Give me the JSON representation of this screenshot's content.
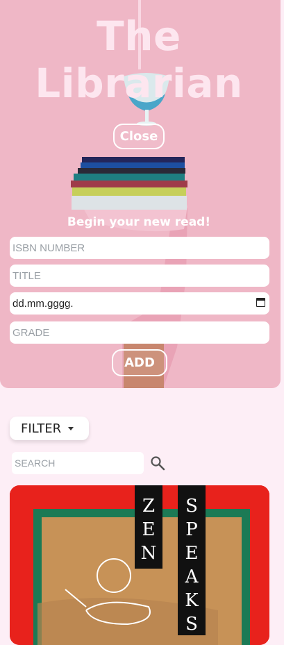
{
  "hero": {
    "title": "The Librarian",
    "close_label": "Close",
    "form_heading": "Begin your new read!",
    "add_label": "ADD"
  },
  "form": {
    "isbn_placeholder": "ISBN NUMBER",
    "title_placeholder": "TITLE",
    "date_value": "dd.mm.gggg.",
    "grade_placeholder": "GRADE"
  },
  "controls": {
    "filter_label": "FILTER",
    "search_placeholder": "SEARCH"
  },
  "book_cover": {
    "left_word": [
      "Z",
      "E",
      "N"
    ],
    "right_word": [
      "S",
      "P",
      "E",
      "A",
      "K",
      "S"
    ]
  }
}
